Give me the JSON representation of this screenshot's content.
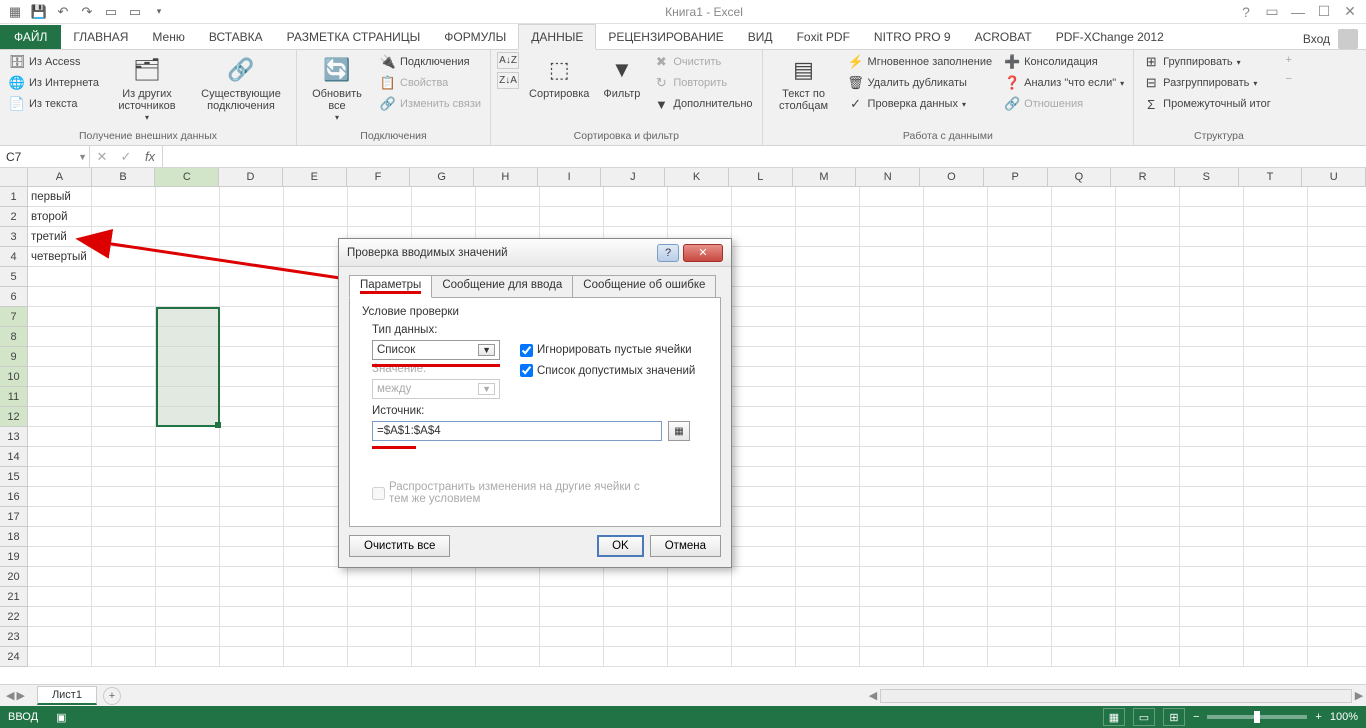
{
  "app": {
    "title": "Книга1 - Excel"
  },
  "tabs": {
    "file": "ФАЙЛ",
    "items": [
      "ГЛАВНАЯ",
      "Меню",
      "ВСТАВКА",
      "РАЗМЕТКА СТРАНИЦЫ",
      "ФОРМУЛЫ",
      "ДАННЫЕ",
      "РЕЦЕНЗИРОВАНИЕ",
      "ВИД",
      "Foxit PDF",
      "NITRO PRO 9",
      "ACROBAT",
      "PDF-XChange 2012"
    ],
    "active_index": 5,
    "signin": "Вход"
  },
  "ribbon": {
    "g1": {
      "label": "Получение внешних данных",
      "access": "Из Access",
      "web": "Из Интернета",
      "text": "Из текста",
      "other": "Из других источников",
      "existing": "Существующие подключения"
    },
    "g2": {
      "label": "Подключения",
      "refresh": "Обновить все",
      "connections": "Подключения",
      "properties": "Свойства",
      "editlinks": "Изменить связи"
    },
    "g3": {
      "label": "Сортировка и фильтр",
      "sort": "Сортировка",
      "filter": "Фильтр",
      "clear": "Очистить",
      "reapply": "Повторить",
      "advanced": "Дополнительно"
    },
    "g4": {
      "label": "Работа с данными",
      "t2c": "Текст по столбцам",
      "flash": "Мгновенное заполнение",
      "dup": "Удалить дубликаты",
      "validate": "Проверка данных",
      "consolidate": "Консолидация",
      "whatif": "Анализ \"что если\"",
      "relations": "Отношения"
    },
    "g5": {
      "label": "Структура",
      "group": "Группировать",
      "ungroup": "Разгруппировать",
      "subtotal": "Промежуточный итог"
    }
  },
  "namebox": "C7",
  "columns": [
    "A",
    "B",
    "C",
    "D",
    "E",
    "F",
    "G",
    "H",
    "I",
    "J",
    "K",
    "L",
    "M",
    "N",
    "O",
    "P",
    "Q",
    "R",
    "S",
    "T",
    "U"
  ],
  "selected_col_index": 2,
  "rows_count": 24,
  "selected_rows": [
    7,
    8,
    9,
    10,
    11,
    12
  ],
  "cells": {
    "A1": "первый",
    "A2": "второй",
    "A3": "третий",
    "A4": "четвертый"
  },
  "sheet": {
    "name": "Лист1"
  },
  "status": {
    "mode": "ВВОД",
    "zoom": "100%"
  },
  "dialog": {
    "title": "Проверка вводимых значений",
    "tabs": [
      "Параметры",
      "Сообщение для ввода",
      "Сообщение об ошибке"
    ],
    "section": "Условие проверки",
    "type_label": "Тип данных:",
    "type_value": "Список",
    "value_label": "Значение:",
    "value_value": "между",
    "ignore_blank": "Игнорировать пустые ячейки",
    "dropdown_list": "Список допустимых значений",
    "source_label": "Источник:",
    "source_value": "=$A$1:$A$4",
    "propagate": "Распространить изменения на другие ячейки с тем же условием",
    "clear": "Очистить все",
    "ok": "OK",
    "cancel": "Отмена"
  }
}
